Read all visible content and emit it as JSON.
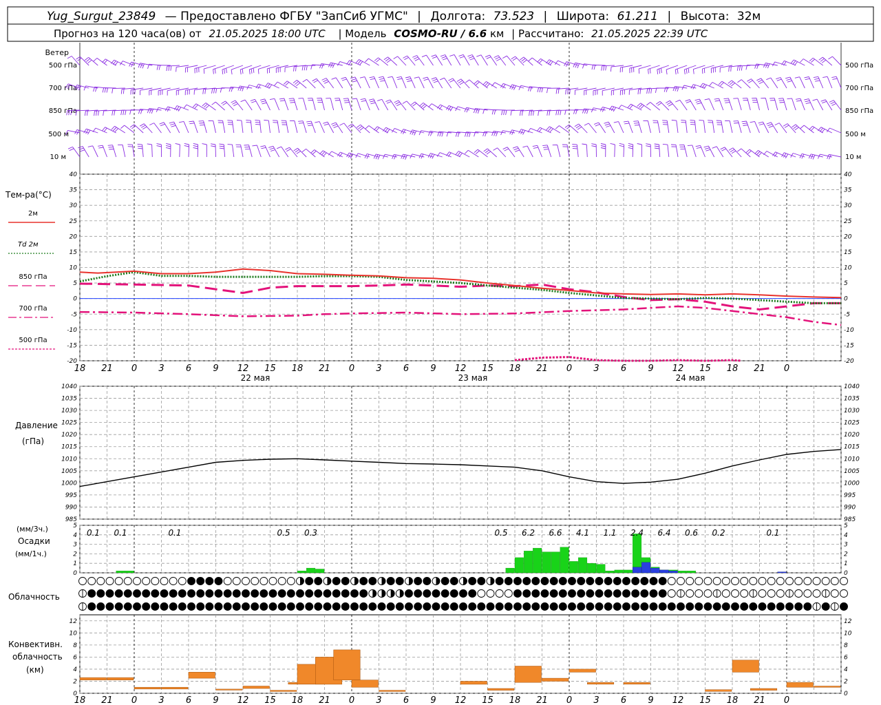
{
  "header": {
    "station": "Yug_Surgut_23849",
    "provider": "— Предоставлено ФГБУ \"ЗапСиб УГМС\"",
    "lon_label": "Долгота:",
    "lon_value": "73.523",
    "lat_label": "Широта:",
    "lat_value": "61.211",
    "alt_label": "Высота:",
    "alt_value": "32м",
    "forecast_label": "Прогноз на 120 часа(ов) от",
    "forecast_from": "21.05.2025 18:00 UTC",
    "model_label": "| Модель",
    "model_name": "COSMO-RU / 6.6",
    "model_unit": "км",
    "calc_label": "| Рассчитано:",
    "calc_value": "21.05.2025 22:39 UTC"
  },
  "time_axis": {
    "hour_labels": [
      "18",
      "21",
      "0",
      "3",
      "6",
      "9",
      "12",
      "15",
      "18",
      "21",
      "0",
      "3",
      "6",
      "9",
      "12",
      "15",
      "18",
      "21",
      "0",
      "3",
      "6",
      "9",
      "12",
      "15",
      "18",
      "21",
      "0"
    ],
    "day_labels": [
      "22 мая",
      "23 мая",
      "24 мая"
    ],
    "start_hour": 18,
    "end_hour": 96
  },
  "panels": {
    "wind": {
      "title": "Ветер",
      "levels": [
        "500 гПа",
        "700 гПа",
        "850 гПа",
        "500 м",
        "10 м"
      ],
      "color": "#8a2be2"
    },
    "temperature": {
      "title": "Тем-ра(°C)",
      "legend": [
        {
          "label": "2м",
          "color": "#e8322c",
          "style": "solid"
        },
        {
          "label": "Td 2м",
          "color": "#1a7a1a",
          "style": "dotted"
        },
        {
          "label": "850 гПа",
          "color": "#e3127a",
          "style": "dashed"
        },
        {
          "label": "700 гПа",
          "color": "#e3127a",
          "style": "dashdot"
        },
        {
          "label": "500 гПа",
          "color": "#e3127a",
          "style": "dotted"
        }
      ],
      "ticks": [
        "40",
        "35",
        "30",
        "25",
        "20",
        "15",
        "10",
        "5",
        "0",
        "-5",
        "-10",
        "-15",
        "-20"
      ]
    },
    "pressure": {
      "title": "Давление",
      "unit": "(гПа)",
      "ticks": [
        "1040",
        "1035",
        "1030",
        "1025",
        "1020",
        "1015",
        "1010",
        "1005",
        "1000",
        "995",
        "990",
        "985"
      ]
    },
    "precip": {
      "unit3": "(мм/3ч.)",
      "title": "Осадки",
      "unit1": "(мм/1ч.)",
      "ticks": [
        "5",
        "4",
        "3",
        "2",
        "1",
        "0"
      ],
      "labels": [
        {
          "text": "0.1",
          "h": 21
        },
        {
          "text": "0.1",
          "h": 24
        },
        {
          "text": "0.1",
          "h": 30
        },
        {
          "text": "0.5",
          "h": 42
        },
        {
          "text": "0.3",
          "h": 45
        },
        {
          "text": "0.5",
          "h": 66
        },
        {
          "text": "6.2",
          "h": 69
        },
        {
          "text": "6.6",
          "h": 72
        },
        {
          "text": "4.1",
          "h": 75
        },
        {
          "text": "1.1",
          "h": 78
        },
        {
          "text": "2.4",
          "h": 81
        },
        {
          "text": "6.4",
          "h": 84
        },
        {
          "text": "0.6",
          "h": 87
        },
        {
          "text": "0.2",
          "h": 90
        },
        {
          "text": "0.1",
          "h": 96
        }
      ]
    },
    "clouds": {
      "title": "Облачность"
    },
    "convective": {
      "title1": "Конвективн.",
      "title2": "облачность",
      "unit": "(км)",
      "ticks": [
        "12",
        "10",
        "8",
        "6",
        "4",
        "2",
        "0"
      ]
    }
  },
  "chart_data": {
    "type": "meteogram",
    "x_hours": "hours since 21.05.2025 00:00 UTC",
    "temperature": {
      "ylim": [
        -20,
        40
      ],
      "t2m": [
        [
          18,
          8.5
        ],
        [
          20,
          8.2
        ],
        [
          24,
          8.8
        ],
        [
          27,
          8.0
        ],
        [
          30,
          8.0
        ],
        [
          33,
          8.5
        ],
        [
          36,
          9.5
        ],
        [
          39,
          9.0
        ],
        [
          42,
          8.0
        ],
        [
          45,
          7.8
        ],
        [
          48,
          7.5
        ],
        [
          51,
          7.3
        ],
        [
          54,
          6.7
        ],
        [
          57,
          6.5
        ],
        [
          60,
          6.0
        ],
        [
          63,
          5.0
        ],
        [
          66,
          4.2
        ],
        [
          69,
          3.3
        ],
        [
          72,
          2.6
        ],
        [
          75,
          1.8
        ],
        [
          78,
          1.5
        ],
        [
          81,
          1.3
        ],
        [
          84,
          1.5
        ],
        [
          87,
          1.2
        ],
        [
          90,
          1.5
        ],
        [
          93,
          1.2
        ],
        [
          96,
          0.8
        ],
        [
          99,
          0.5
        ],
        [
          102,
          0.3
        ]
      ],
      "td2m": [
        [
          18,
          5.5
        ],
        [
          21,
          7.2
        ],
        [
          24,
          8.5
        ],
        [
          27,
          7.3
        ],
        [
          30,
          7.3
        ],
        [
          33,
          7.0
        ],
        [
          36,
          7.0
        ],
        [
          39,
          7.0
        ],
        [
          42,
          7.0
        ],
        [
          45,
          7.2
        ],
        [
          48,
          7.2
        ],
        [
          51,
          7.0
        ],
        [
          54,
          6.0
        ],
        [
          57,
          5.5
        ],
        [
          60,
          5.0
        ],
        [
          63,
          4.2
        ],
        [
          66,
          3.5
        ],
        [
          69,
          2.8
        ],
        [
          72,
          1.8
        ],
        [
          75,
          1.0
        ],
        [
          78,
          0.2
        ],
        [
          81,
          0.0
        ],
        [
          84,
          -0.2
        ],
        [
          87,
          0.2
        ],
        [
          90,
          0.0
        ],
        [
          93,
          -0.5
        ],
        [
          96,
          -1.0
        ],
        [
          99,
          -1.5
        ],
        [
          102,
          -1.5
        ]
      ],
      "t850": [
        [
          18,
          4.8
        ],
        [
          24,
          4.5
        ],
        [
          30,
          4.2
        ],
        [
          33,
          3.0
        ],
        [
          36,
          1.8
        ],
        [
          39,
          3.5
        ],
        [
          42,
          4.0
        ],
        [
          45,
          4.0
        ],
        [
          48,
          4.0
        ],
        [
          51,
          4.2
        ],
        [
          54,
          4.5
        ],
        [
          57,
          4.2
        ],
        [
          60,
          3.8
        ],
        [
          63,
          4.2
        ],
        [
          66,
          4.0
        ],
        [
          69,
          4.5
        ],
        [
          72,
          3.0
        ],
        [
          75,
          2.0
        ],
        [
          78,
          0.5
        ],
        [
          81,
          -0.5
        ],
        [
          84,
          -0.2
        ],
        [
          87,
          -1.0
        ],
        [
          90,
          -2.5
        ],
        [
          93,
          -3.5
        ],
        [
          96,
          -2.5
        ],
        [
          99,
          -1.5
        ],
        [
          102,
          -1.5
        ]
      ],
      "t700": [
        [
          18,
          -4.3
        ],
        [
          24,
          -4.5
        ],
        [
          30,
          -5.0
        ],
        [
          36,
          -5.7
        ],
        [
          42,
          -5.5
        ],
        [
          45,
          -5.0
        ],
        [
          48,
          -4.8
        ],
        [
          54,
          -4.5
        ],
        [
          60,
          -5.0
        ],
        [
          66,
          -4.8
        ],
        [
          72,
          -4.0
        ],
        [
          78,
          -3.5
        ],
        [
          81,
          -3.0
        ],
        [
          84,
          -2.5
        ],
        [
          87,
          -3.0
        ],
        [
          90,
          -4.0
        ],
        [
          93,
          -5.0
        ],
        [
          96,
          -6.0
        ],
        [
          99,
          -7.5
        ],
        [
          102,
          -8.5
        ]
      ],
      "t500": [
        [
          66,
          -19.8
        ],
        [
          69,
          -19.0
        ],
        [
          72,
          -18.8
        ],
        [
          75,
          -19.8
        ],
        [
          78,
          -20.0
        ],
        [
          81,
          -20.0
        ],
        [
          84,
          -19.8
        ],
        [
          87,
          -20.0
        ],
        [
          90,
          -19.8
        ],
        [
          91,
          -20.0
        ]
      ]
    },
    "pressure": {
      "ylim": [
        985,
        1040
      ],
      "values": [
        [
          18,
          998.5
        ],
        [
          21,
          1000.5
        ],
        [
          24,
          1002.5
        ],
        [
          27,
          1004.5
        ],
        [
          30,
          1006.5
        ],
        [
          33,
          1008.5
        ],
        [
          36,
          1009.3
        ],
        [
          39,
          1009.8
        ],
        [
          42,
          1010.0
        ],
        [
          45,
          1009.5
        ],
        [
          48,
          1009.0
        ],
        [
          51,
          1008.5
        ],
        [
          54,
          1008.0
        ],
        [
          57,
          1007.8
        ],
        [
          60,
          1007.5
        ],
        [
          63,
          1007.0
        ],
        [
          66,
          1006.5
        ],
        [
          69,
          1005.0
        ],
        [
          72,
          1002.5
        ],
        [
          75,
          1000.5
        ],
        [
          78,
          999.8
        ],
        [
          81,
          1000.3
        ],
        [
          84,
          1001.5
        ],
        [
          87,
          1004.0
        ],
        [
          90,
          1007.0
        ],
        [
          93,
          1009.5
        ],
        [
          96,
          1011.8
        ],
        [
          99,
          1013.0
        ],
        [
          102,
          1013.8
        ]
      ]
    },
    "precip": {
      "ylim": [
        0,
        5
      ],
      "green": [
        [
          22,
          0.2
        ],
        [
          23,
          0.2
        ],
        [
          42,
          0.2
        ],
        [
          43,
          0.5
        ],
        [
          44,
          0.4
        ],
        [
          65,
          0.5
        ],
        [
          66,
          1.6
        ],
        [
          67,
          2.3
        ],
        [
          68,
          2.6
        ],
        [
          69,
          2.2
        ],
        [
          70,
          2.2
        ],
        [
          71,
          2.7
        ],
        [
          72,
          1.2
        ],
        [
          73,
          1.6
        ],
        [
          74,
          1.0
        ],
        [
          75,
          0.9
        ],
        [
          76,
          0.2
        ],
        [
          77,
          0.3
        ],
        [
          78,
          0.3
        ],
        [
          79,
          4.1
        ],
        [
          80,
          1.6
        ],
        [
          81,
          0.6
        ],
        [
          82,
          0.3
        ],
        [
          83,
          0.3
        ],
        [
          84,
          0.2
        ],
        [
          85,
          0.2
        ]
      ],
      "blue": [
        [
          79,
          0.6
        ],
        [
          80,
          1.1
        ],
        [
          81,
          0.5
        ],
        [
          82,
          0.3
        ],
        [
          83,
          0.2
        ],
        [
          95,
          0.1
        ]
      ]
    },
    "cloud_cover": {
      "rows": 3,
      "symbols_note": "0=clear,1=quarter,2=half,3=three-quarter,4=overcast"
    },
    "convective": {
      "ylim": [
        0,
        13
      ],
      "bars": [
        [
          18,
          2.2,
          2.6
        ],
        [
          21,
          2.2,
          2.6
        ],
        [
          24,
          0.7,
          1.0
        ],
        [
          27,
          0.7,
          1.0
        ],
        [
          30,
          2.5,
          3.5
        ],
        [
          33,
          1.0,
          0.7
        ],
        [
          36,
          0.8,
          1.2
        ],
        [
          39,
          0.3,
          0.5
        ],
        [
          41,
          1.5,
          1.8
        ],
        [
          42,
          1.5,
          4.8
        ],
        [
          44,
          1.5,
          6.0
        ],
        [
          46,
          2.2,
          7.2
        ],
        [
          48,
          1.0,
          2.2
        ],
        [
          51,
          0.3,
          0.5
        ],
        [
          60,
          1.5,
          2.0
        ],
        [
          63,
          0.5,
          0.8
        ],
        [
          66,
          1.8,
          4.5
        ],
        [
          69,
          2.0,
          2.5
        ],
        [
          72,
          3.5,
          4.0
        ],
        [
          74,
          1.5,
          1.8
        ],
        [
          78,
          1.5,
          1.8
        ],
        [
          87,
          0.3,
          0.6
        ],
        [
          90,
          3.5,
          5.5
        ],
        [
          92,
          0.5,
          0.8
        ],
        [
          96,
          1.0,
          1.8
        ],
        [
          99,
          1.0,
          1.2
        ]
      ]
    }
  }
}
